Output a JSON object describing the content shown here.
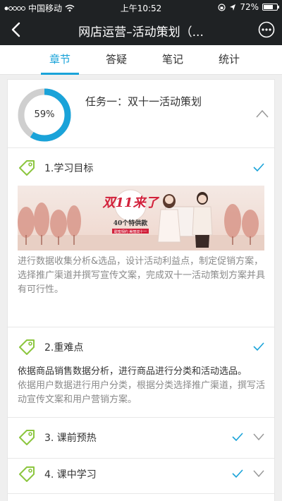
{
  "status_bar": {
    "carrier": "中国移动",
    "time": "上午10:52",
    "battery": "72%",
    "battery_level": 0.72
  },
  "nav": {
    "title": "网店运营–活动策划（...",
    "back_icon": "back-chevron-icon",
    "more_icon": "more-dots-icon"
  },
  "tabs": [
    {
      "label": "章节",
      "active": true
    },
    {
      "label": "答疑",
      "active": false
    },
    {
      "label": "笔记",
      "active": false
    },
    {
      "label": "统计",
      "active": false
    }
  ],
  "task": {
    "progress_label": "59%",
    "progress": 0.59,
    "title": "任务一：双十一活动策划"
  },
  "sections": [
    {
      "label": "1.学习目标",
      "done": true
    },
    {
      "label": "2.重难点",
      "done": true
    },
    {
      "label": "3. 课前预热",
      "done": true
    },
    {
      "label": "4. 课中学习",
      "done": true
    }
  ],
  "banner": {
    "headline": "双11来了",
    "sub": "40个特供款",
    "tagline": "甜蜜相约 美丽双十一"
  },
  "objective_text": "进行数据收集分析&选品，设计活动利益点，制定促销方案，选择推广渠道并撰写宣传文案，完成双十一活动策划方案并具有可行性。",
  "keypoints": {
    "line1": "依据商品销售数据分析，进行商品进行分类和活动选品。",
    "line2": "依据用户数据进行用户分类，根据分类选择推广渠道，撰写活动宣传文案和用户营销方案。"
  },
  "colors": {
    "accent": "#1aa3d9",
    "tag_green": "#8cc63f",
    "nav_bg": "#1f2224"
  }
}
